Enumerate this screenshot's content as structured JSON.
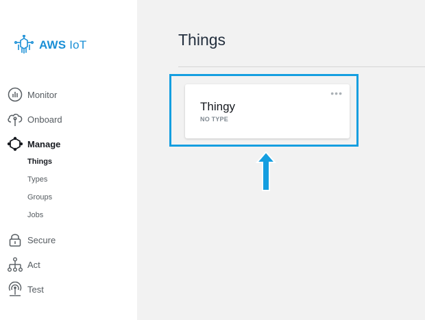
{
  "sidebar": {
    "logo": {
      "bold": "AWS",
      "text": " IoT"
    },
    "items": [
      {
        "label": "Monitor",
        "icon": "monitor-icon"
      },
      {
        "label": "Onboard",
        "icon": "cloud-icon"
      },
      {
        "label": "Manage",
        "icon": "manage-icon",
        "active": true
      },
      {
        "label": "Secure",
        "icon": "lock-icon"
      },
      {
        "label": "Act",
        "icon": "hierarchy-icon"
      },
      {
        "label": "Test",
        "icon": "signal-icon"
      }
    ],
    "subitems": [
      {
        "label": "Things",
        "active": true
      },
      {
        "label": "Types"
      },
      {
        "label": "Groups"
      },
      {
        "label": "Jobs"
      }
    ]
  },
  "main": {
    "title": "Things",
    "card": {
      "title": "Thingy",
      "subtitle": "NO TYPE",
      "menu": "•••"
    }
  },
  "colors": {
    "accent": "#149ee0",
    "brand": "#1a8fd6",
    "background": "#f2f2f2"
  }
}
